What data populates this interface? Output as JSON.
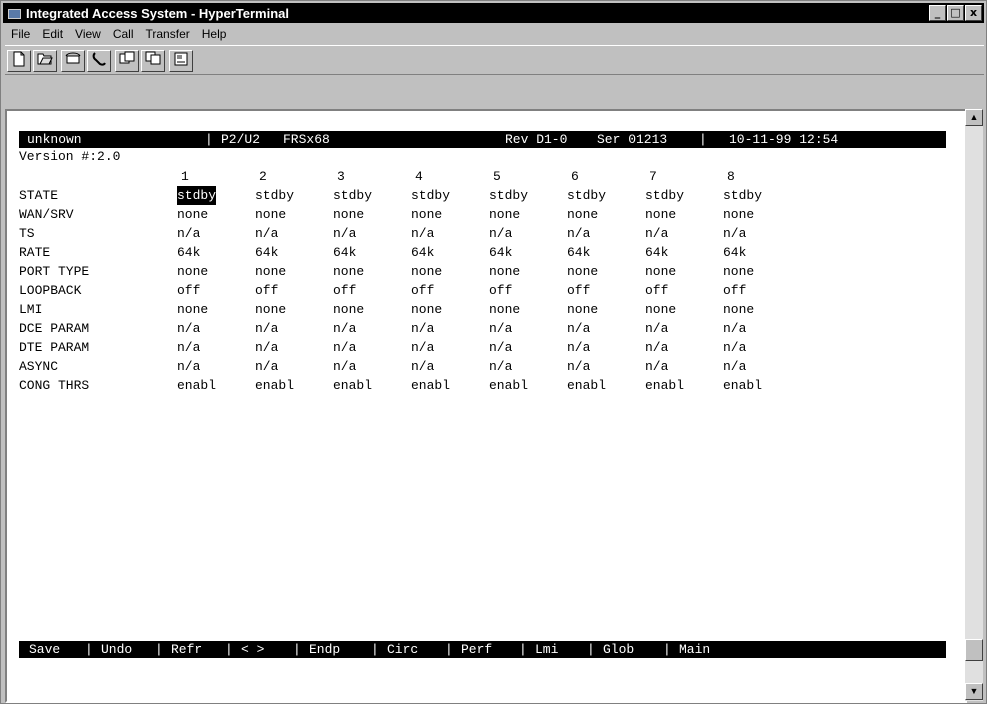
{
  "window": {
    "title": "Integrated Access System - HyperTerminal",
    "controls": {
      "minimize": "_",
      "maximize": "□",
      "close": "x"
    }
  },
  "menu": [
    "File",
    "Edit",
    "View",
    "Call",
    "Transfer",
    "Help"
  ],
  "toolbar": {
    "icons": [
      "new-icon",
      "open-icon",
      "connect-icon",
      "disconnect-icon",
      "send-icon",
      "receive-icon",
      "properties-icon"
    ]
  },
  "terminal": {
    "status": {
      "name": "unknown",
      "sep1": "|",
      "slot": "P2/U2",
      "card": "FRSx68",
      "rev": "Rev D1-0",
      "ser": "Ser 01213",
      "sep2": "|",
      "datetime": "10-11-99 12:54"
    },
    "version": "Version #:2.0",
    "columns": [
      "1",
      "2",
      "3",
      "4",
      "5",
      "6",
      "7",
      "8"
    ],
    "rows": [
      {
        "label": "STATE",
        "values": [
          "stdby",
          "stdby",
          "stdby",
          "stdby",
          "stdby",
          "stdby",
          "stdby",
          "stdby"
        ]
      },
      {
        "label": "WAN/SRV",
        "values": [
          "none",
          "none",
          "none",
          "none",
          "none",
          "none",
          "none",
          "none"
        ]
      },
      {
        "label": "TS",
        "values": [
          "n/a",
          "n/a",
          "n/a",
          "n/a",
          "n/a",
          "n/a",
          "n/a",
          "n/a"
        ]
      },
      {
        "label": "RATE",
        "values": [
          "64k",
          "64k",
          "64k",
          "64k",
          "64k",
          "64k",
          "64k",
          "64k"
        ]
      },
      {
        "label": "PORT TYPE",
        "values": [
          "none",
          "none",
          "none",
          "none",
          "none",
          "none",
          "none",
          "none"
        ]
      },
      {
        "label": "LOOPBACK",
        "values": [
          "off",
          "off",
          "off",
          "off",
          "off",
          "off",
          "off",
          "off"
        ]
      },
      {
        "label": "LMI",
        "values": [
          "none",
          "none",
          "none",
          "none",
          "none",
          "none",
          "none",
          "none"
        ]
      },
      {
        "label": "DCE PARAM",
        "values": [
          "n/a",
          "n/a",
          "n/a",
          "n/a",
          "n/a",
          "n/a",
          "n/a",
          "n/a"
        ]
      },
      {
        "label": "DTE PARAM",
        "values": [
          "n/a",
          "n/a",
          "n/a",
          "n/a",
          "n/a",
          "n/a",
          "n/a",
          "n/a"
        ]
      },
      {
        "label": "ASYNC",
        "values": [
          "n/a",
          "n/a",
          "n/a",
          "n/a",
          "n/a",
          "n/a",
          "n/a",
          "n/a"
        ]
      },
      {
        "label": "CONG THRS",
        "values": [
          "enabl",
          "enabl",
          "enabl",
          "enabl",
          "enabl",
          "enabl",
          "enabl",
          "enabl"
        ]
      }
    ],
    "commands": [
      "Save",
      "Undo",
      "Refr",
      "< >",
      "Endp",
      "Circ",
      "Perf",
      "Lmi",
      "Glob",
      "Main"
    ],
    "command_sep": "|"
  }
}
